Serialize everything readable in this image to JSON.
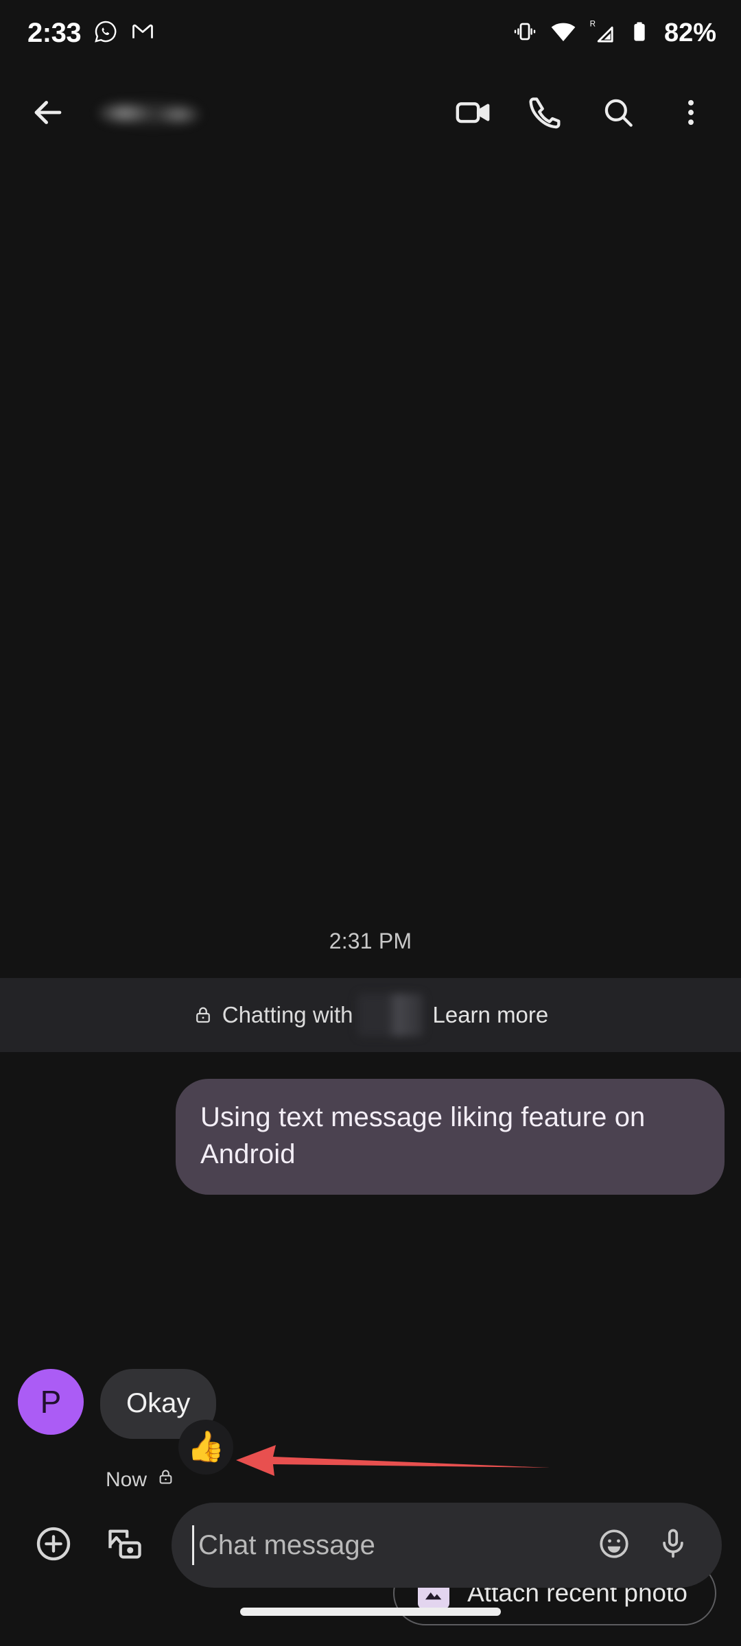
{
  "status_bar": {
    "time": "2:33",
    "battery_percent": "82%",
    "icons": [
      "whatsapp-icon",
      "gmail-icon",
      "vibrate-icon",
      "wifi-icon",
      "cellular-signal-roaming-icon",
      "battery-icon"
    ],
    "roaming_label": "R"
  },
  "app_bar": {
    "back_label": "back-arrow",
    "contact_name": "",
    "contact_name_redacted": true,
    "actions": [
      {
        "name": "video-call-button",
        "label": "Video call"
      },
      {
        "name": "voice-call-button",
        "label": "Call"
      },
      {
        "name": "search-button",
        "label": "Search"
      },
      {
        "name": "more-options-button",
        "label": "More options"
      }
    ]
  },
  "conversation": {
    "timestamp_divider": "2:31 PM",
    "encryption_banner": {
      "lock_icon": "lock-icon",
      "prefix_text": "Chatting with",
      "contact_redacted": true,
      "link_text": "Learn more"
    },
    "messages": [
      {
        "direction": "outgoing",
        "text": "Using text message liking feature on Android",
        "bubble_color": "#4b4250"
      },
      {
        "direction": "incoming",
        "avatar_initial": "P",
        "avatar_color": "#ab5cf5",
        "text": "Okay",
        "bubble_color": "#323235",
        "reaction": "👍",
        "meta_time": "Now",
        "meta_lock_icon": "lock-icon"
      }
    ]
  },
  "annotation": {
    "type": "arrow",
    "color": "#e8504f",
    "direction": "points-left",
    "target": "reaction-badge"
  },
  "suggestions": [
    {
      "name": "attach-recent-photo-chip",
      "label": "Attach recent photo",
      "icon": "image-icon"
    }
  ],
  "composer": {
    "add_button": "plus-circle-icon",
    "gallery_button": "gallery-camera-icon",
    "placeholder": "Chat message",
    "value": "",
    "emoji_button": "emoji-smiley-icon",
    "mic_button": "microphone-icon"
  },
  "colors": {
    "background": "#131313",
    "banner_background": "#232326",
    "outgoing_bubble": "#4b4250",
    "incoming_bubble": "#323235",
    "avatar": "#ab5cf5",
    "annotation": "#e8504f"
  }
}
